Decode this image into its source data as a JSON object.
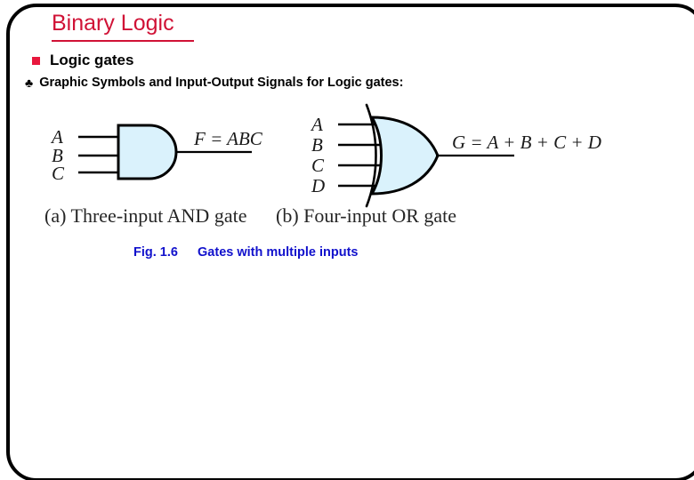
{
  "slide": {
    "title": "Binary Logic",
    "title_color": "#d01236",
    "frame_color": "#000000",
    "background": "#ffffff"
  },
  "bullets": [
    {
      "marker": "square-bullet",
      "marker_color": "#e8173d",
      "text": "Logic gates"
    },
    {
      "marker": "club-bullet",
      "marker_glyph": "♣",
      "marker_color": "#000000",
      "text": "Graphic Symbols and Input-Output Signals for Logic gates:"
    }
  ],
  "figure": {
    "gate_fill": "#daf2fc",
    "gate_stroke": "#000000",
    "and_gate": {
      "caption": "(a) Three-input AND gate",
      "inputs": [
        "A",
        "B",
        "C"
      ],
      "output_expression": "F = ABC"
    },
    "or_gate": {
      "caption": "(b) Four-input OR gate",
      "inputs": [
        "A",
        "B",
        "C",
        "D"
      ],
      "output_expression": "G = A + B + C + D"
    }
  },
  "figure_caption": {
    "number": "Fig. 1.6",
    "text": "Gates with multiple inputs",
    "color": "#1111cc"
  }
}
